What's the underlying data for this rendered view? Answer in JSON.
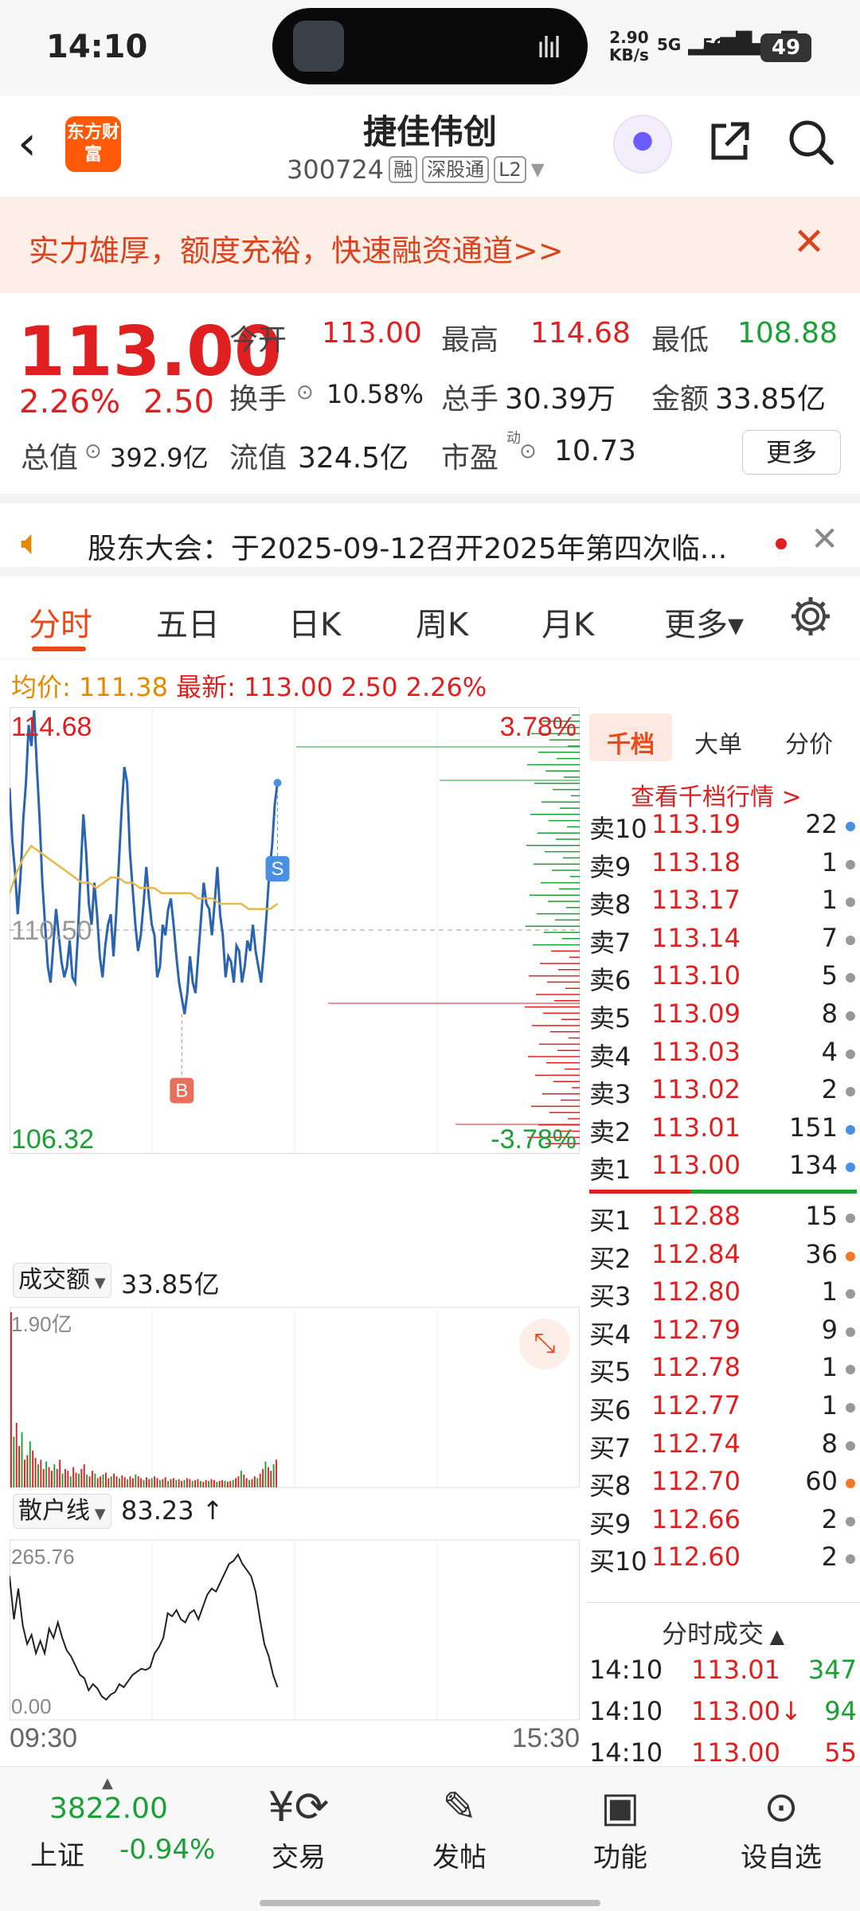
{
  "status_bar": {
    "time": "14:10",
    "net_speed_value": "2.90",
    "net_speed_unit": "KB/s",
    "signal1": "5G",
    "signal2": "5G",
    "battery": "49"
  },
  "header": {
    "brand_logo_text": "东方财富",
    "stock_name": "捷佳伟创",
    "stock_code": "300724",
    "tags": [
      "融",
      "深股通",
      "L2"
    ]
  },
  "banner": {
    "text": "实力雄厚，额度充裕，快速融资通道>>"
  },
  "quote": {
    "price": "113.00",
    "change_pct": "2.26%",
    "change": "2.50",
    "open_label": "今开",
    "open": "113.00",
    "high_label": "最高",
    "high": "114.68",
    "low_label": "最低",
    "low": "108.88",
    "turnover_label": "换手",
    "turnover": "10.58%",
    "volume_label": "总手",
    "volume": "30.39万",
    "amount_label": "金额",
    "amount": "33.85亿",
    "mcap_label": "总值",
    "mcap": "392.9亿",
    "float_label": "流值",
    "float": "324.5亿",
    "pe_label": "市盈",
    "pe_sup": "动",
    "pe": "10.73",
    "more_label": "更多"
  },
  "announcement": {
    "text": "股东大会：于2025-09-12召开2025年第四次临..."
  },
  "tabs": [
    {
      "label": "分时"
    },
    {
      "label": "五日"
    },
    {
      "label": "日K"
    },
    {
      "label": "周K"
    },
    {
      "label": "月K"
    },
    {
      "label": "更多▾"
    }
  ],
  "chart_info": {
    "avg_label": "均价:",
    "avg": "111.38",
    "latest_label": "最新:",
    "latest": "113.00",
    "change": "2.50",
    "pct": "2.26%"
  },
  "chart_data": [
    {
      "type": "line",
      "title": "",
      "xlabel": "",
      "ylabel": "",
      "x_ticks": [
        "09:30",
        "15:30"
      ],
      "ylim": [
        106.32,
        114.68
      ],
      "y_labels_left": [
        "114.68",
        "110.50",
        "106.32"
      ],
      "y_labels_right": [
        "3.78%",
        "-3.78%"
      ],
      "prev_close": 110.5,
      "series": [
        {
          "name": "",
          "color": "#2a64b0",
          "values": [
            113.2,
            112.2,
            111.6,
            110.8,
            111.5,
            112.6,
            113.3,
            114.4,
            114.0,
            114.68,
            113.6,
            112.6,
            111.4,
            110.6,
            109.8,
            109.5,
            110.2,
            110.9,
            110.4,
            109.9,
            109.6,
            109.8,
            110.3,
            109.6,
            109.5,
            110.4,
            111.6,
            112.7,
            112.0,
            111.0,
            110.6,
            111.4,
            110.8,
            110.0,
            109.6,
            110.2,
            110.6,
            110.8,
            110.0,
            110.8,
            111.8,
            112.8,
            113.6,
            113.3,
            112.0,
            111.3,
            110.6,
            110.1,
            110.4,
            111.0,
            111.7,
            111.1,
            110.6,
            110.4,
            109.6,
            109.8,
            110.6,
            110.4,
            110.9,
            111.1,
            110.6,
            110.0,
            109.5,
            109.2,
            108.9,
            109.3,
            110.0,
            109.5,
            109.3,
            110.0,
            110.7,
            111.4,
            111.0,
            110.9,
            110.4,
            111.0,
            111.7,
            110.8,
            110.4,
            109.6,
            110.0,
            109.9,
            109.5,
            110.2,
            110.1,
            109.5,
            109.8,
            110.3,
            110.1,
            110.6,
            110.1,
            109.8,
            109.5,
            110.1,
            110.8,
            111.6,
            112.1,
            112.9,
            113.3
          ]
        },
        {
          "name": "均价",
          "color": "#e8b84a",
          "values": [
            111.2,
            111.6,
            111.9,
            112.1,
            112.0,
            111.9,
            111.8,
            111.7,
            111.6,
            111.5,
            111.4,
            111.4,
            111.3,
            111.4,
            111.5,
            111.5,
            111.4,
            111.4,
            111.3,
            111.3,
            111.3,
            111.2,
            111.2,
            111.2,
            111.2,
            111.2,
            111.1,
            111.1,
            111.1,
            111.0,
            111.0,
            111.0,
            111.0,
            110.9,
            110.9,
            110.9,
            110.9,
            111.0
          ]
        }
      ],
      "markers": [
        {
          "label": "B",
          "color": "#e8705a"
        },
        {
          "label": "S",
          "color": "#4a90e2"
        }
      ]
    },
    {
      "type": "bar",
      "title": "成交额",
      "total": "33.85亿",
      "ymax_label": "1.90亿",
      "values": [
        1.9,
        0.55,
        0.7,
        0.45,
        0.6,
        0.3,
        0.35,
        0.5,
        0.4,
        0.32,
        0.25,
        0.3,
        0.2,
        0.28,
        0.22,
        0.18,
        0.25,
        0.2,
        0.3,
        0.15,
        0.2,
        0.18,
        0.12,
        0.22,
        0.16,
        0.15,
        0.2,
        0.25,
        0.14,
        0.12,
        0.18,
        0.15,
        0.1,
        0.12,
        0.14,
        0.16,
        0.1,
        0.12,
        0.15,
        0.12,
        0.1,
        0.13,
        0.11,
        0.09,
        0.12,
        0.1,
        0.14,
        0.12,
        0.1,
        0.08,
        0.11,
        0.09,
        0.1,
        0.12,
        0.1,
        0.08,
        0.09,
        0.11,
        0.07,
        0.09,
        0.1,
        0.08,
        0.09,
        0.07,
        0.08,
        0.1,
        0.09,
        0.07,
        0.08,
        0.09,
        0.07,
        0.06,
        0.08,
        0.07,
        0.09,
        0.08,
        0.06,
        0.07,
        0.08,
        0.07,
        0.06,
        0.07,
        0.08,
        0.1,
        0.12,
        0.18,
        0.14,
        0.1,
        0.08,
        0.09,
        0.12,
        0.1,
        0.15,
        0.2,
        0.28,
        0.22,
        0.18,
        0.25,
        0.3
      ]
    },
    {
      "type": "line",
      "title": "散户线",
      "current": "83.23 ↑",
      "ylim": [
        0.0,
        265.76
      ],
      "y_labels": [
        "265.76",
        "0.00"
      ],
      "series": [
        {
          "name": "",
          "color": "#222",
          "values": [
            220,
            150,
            200,
            140,
            110,
            125,
            95,
            115,
            95,
            135,
            120,
            145,
            120,
            100,
            90,
            75,
            60,
            55,
            35,
            45,
            38,
            25,
            20,
            28,
            32,
            45,
            40,
            50,
            60,
            65,
            70,
            68,
            72,
            95,
            105,
            120,
            160,
            155,
            165,
            150,
            145,
            160,
            165,
            150,
            170,
            190,
            200,
            195,
            210,
            225,
            240,
            245,
            255,
            240,
            230,
            220,
            195,
            150,
            110,
            90,
            60,
            40
          ]
        }
      ]
    }
  ],
  "orderbook": {
    "tabs": [
      "千档",
      "大单",
      "分价"
    ],
    "link": "查看千档行情 >",
    "sells": [
      {
        "label": "卖10",
        "price": "113.19",
        "vol": "22",
        "dot": "#4a90e2"
      },
      {
        "label": "卖9",
        "price": "113.18",
        "vol": "1",
        "dot": "#999"
      },
      {
        "label": "卖8",
        "price": "113.17",
        "vol": "1",
        "dot": "#999"
      },
      {
        "label": "卖7",
        "price": "113.14",
        "vol": "7",
        "dot": "#999"
      },
      {
        "label": "卖6",
        "price": "113.10",
        "vol": "5",
        "dot": "#999"
      },
      {
        "label": "卖5",
        "price": "113.09",
        "vol": "8",
        "dot": "#999"
      },
      {
        "label": "卖4",
        "price": "113.03",
        "vol": "4",
        "dot": "#999"
      },
      {
        "label": "卖3",
        "price": "113.02",
        "vol": "2",
        "dot": "#999"
      },
      {
        "label": "卖2",
        "price": "113.01",
        "vol": "151",
        "dot": "#4a90e2"
      },
      {
        "label": "卖1",
        "price": "113.00",
        "vol": "134",
        "dot": "#4a90e2"
      }
    ],
    "buys": [
      {
        "label": "买1",
        "price": "112.88",
        "vol": "15",
        "dot": "#999"
      },
      {
        "label": "买2",
        "price": "112.84",
        "vol": "36",
        "dot": "#f07a2a"
      },
      {
        "label": "买3",
        "price": "112.80",
        "vol": "1",
        "dot": "#999"
      },
      {
        "label": "买4",
        "price": "112.79",
        "vol": "9",
        "dot": "#999"
      },
      {
        "label": "买5",
        "price": "112.78",
        "vol": "1",
        "dot": "#999"
      },
      {
        "label": "买6",
        "price": "112.77",
        "vol": "1",
        "dot": "#999"
      },
      {
        "label": "买7",
        "price": "112.74",
        "vol": "8",
        "dot": "#999"
      },
      {
        "label": "买8",
        "price": "112.70",
        "vol": "60",
        "dot": "#f07a2a"
      },
      {
        "label": "买9",
        "price": "112.66",
        "vol": "2",
        "dot": "#999"
      },
      {
        "label": "买10",
        "price": "112.60",
        "vol": "2",
        "dot": "#999"
      }
    ],
    "trades_title": "分时成交",
    "trades": [
      {
        "time": "14:10",
        "price": "113.01",
        "vol": "347",
        "price_color": "#e02020",
        "vol_color": "#1aa034"
      },
      {
        "time": "14:10",
        "price": "113.00↓",
        "vol": "94",
        "price_color": "#e02020",
        "vol_color": "#1aa034"
      },
      {
        "time": "14:10",
        "price": "113.00",
        "vol": "55",
        "price_color": "#e02020",
        "vol_color": "#e02020"
      }
    ]
  },
  "bottom_nav": {
    "index_value": "3822.00",
    "index_name": "上证",
    "index_pct": "-0.94%",
    "items": [
      {
        "label": "交易",
        "icon": "yen-cycle-icon"
      },
      {
        "label": "发帖",
        "icon": "edit-icon"
      },
      {
        "label": "功能",
        "icon": "grid-icon"
      },
      {
        "label": "设自选",
        "icon": "more-dots-icon"
      }
    ]
  }
}
